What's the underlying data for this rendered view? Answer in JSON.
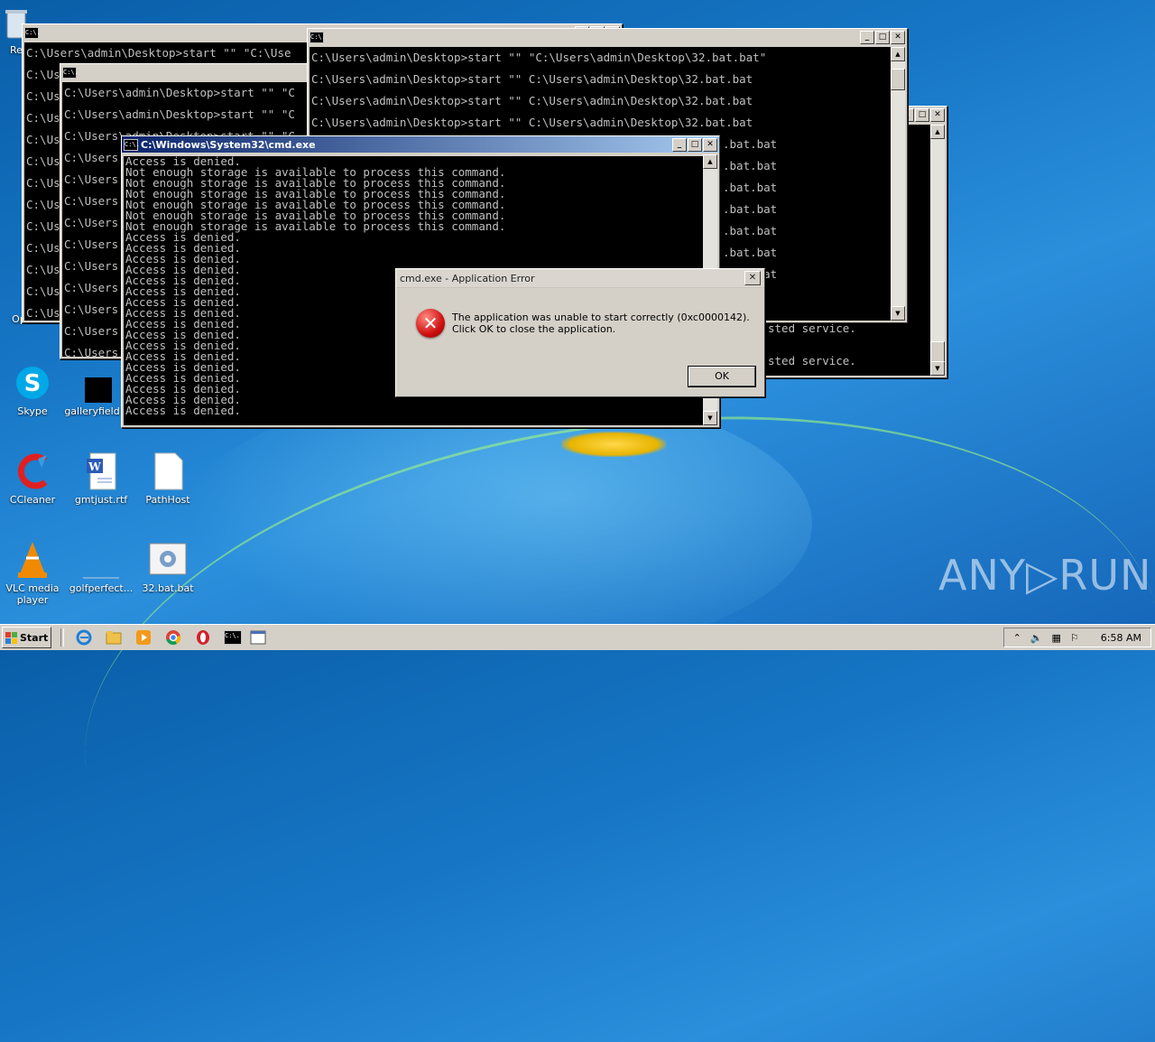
{
  "desktop": {
    "icons": [
      {
        "label": "Re",
        "icon": "recycle-bin-icon"
      },
      {
        "label": "Opera",
        "icon": "opera-icon"
      },
      {
        "label": "Skype",
        "icon": "skype-icon"
      },
      {
        "label": "galleryfield",
        "icon": "file-icon"
      },
      {
        "label": "CCleaner",
        "icon": "ccleaner-icon"
      },
      {
        "label": "gmtjust.rtf",
        "icon": "word-document-icon"
      },
      {
        "label": "PathHost",
        "icon": "blank-file-icon"
      },
      {
        "label": "VLC media player",
        "icon": "vlc-icon"
      },
      {
        "label": "golfperfect...",
        "icon": "file-icon"
      },
      {
        "label": "32.bat.bat",
        "icon": "batch-file-icon"
      }
    ]
  },
  "windows": {
    "back_left": {
      "title": "",
      "lines": [
        "C:\\Users\\admin\\Desktop>start \"\" \"C:\\Use",
        "C:\\Us",
        "C:\\Us",
        "C:\\Us",
        "C:\\Us",
        "C:\\Us",
        "C:\\Us",
        "C:\\Us",
        "C:\\Us",
        "C:\\Us",
        "C:\\Us",
        "C:\\Us",
        "C:\\Us"
      ]
    },
    "back_mid": {
      "title": "",
      "lines": [
        "C:\\Users\\admin\\Desktop>start \"\" \"C",
        "C:\\Users\\admin\\Desktop>start \"\" \"C",
        "C:\\Users\\admin\\Desktop>start \"\" \"C",
        "C:\\Users",
        "C:\\Users",
        "C:\\Users",
        "C:\\Users",
        "C:\\Users",
        "C:\\Users",
        "C:\\Users",
        "C:\\Users",
        "C:\\Users",
        "C:\\Users"
      ]
    },
    "back_right": {
      "title": "",
      "lines": [
        "C:\\Users\\admin\\Desktop>start \"\" \"C:\\Users\\admin\\Desktop\\32.bat.bat\"",
        "C:\\Users\\admin\\Desktop>start \"\" C:\\Users\\admin\\Desktop\\32.bat.bat",
        "C:\\Users\\admin\\Desktop>start \"\" C:\\Users\\admin\\Desktop\\32.bat.bat",
        "C:\\Users\\admin\\Desktop>start \"\" C:\\Users\\admin\\Desktop\\32.bat.bat",
        ".bat.bat",
        ".bat.bat",
        ".bat.bat",
        ".bat.bat",
        ".bat.bat",
        ".bat.bat",
        ".bat.bat",
        ".bat.bat"
      ]
    },
    "far_right": {
      "lines": [
        "sted service.",
        "sted service."
      ]
    },
    "front": {
      "title": "C:\\Windows\\System32\\cmd.exe",
      "lines": [
        "Access is denied.",
        "Not enough storage is available to process this command.",
        "Not enough storage is available to process this command.",
        "Not enough storage is available to process this command.",
        "Not enough storage is available to process this command.",
        "Not enough storage is available to process this command.",
        "Not enough storage is available to process this command.",
        "Access is denied.",
        "Access is denied.",
        "Access is denied.",
        "Access is denied.",
        "Access is denied.",
        "Access is denied.",
        "Access is denied.",
        "Access is denied.",
        "Access is denied.",
        "Access is denied.",
        "Access is denied.",
        "Access is denied.",
        "Access is denied.",
        "Access is denied.",
        "Access is denied.",
        "Access is denied.",
        "Access is denied."
      ]
    }
  },
  "dialog": {
    "title": "cmd.exe - Application Error",
    "message": "The application was unable to start correctly (0xc0000142). Click OK to close the application.",
    "ok_label": "OK",
    "close_glyph": "✕",
    "icon_glyph": "✕"
  },
  "taskbar": {
    "start_label": "Start",
    "clock": "6:58 AM",
    "tray_icons": [
      "show-hidden-icons-icon",
      "volume-icon",
      "network-icon",
      "action-center-flag-icon"
    ]
  },
  "console_icon_text": "C:\\.",
  "watermark": "ANY▷RUN"
}
